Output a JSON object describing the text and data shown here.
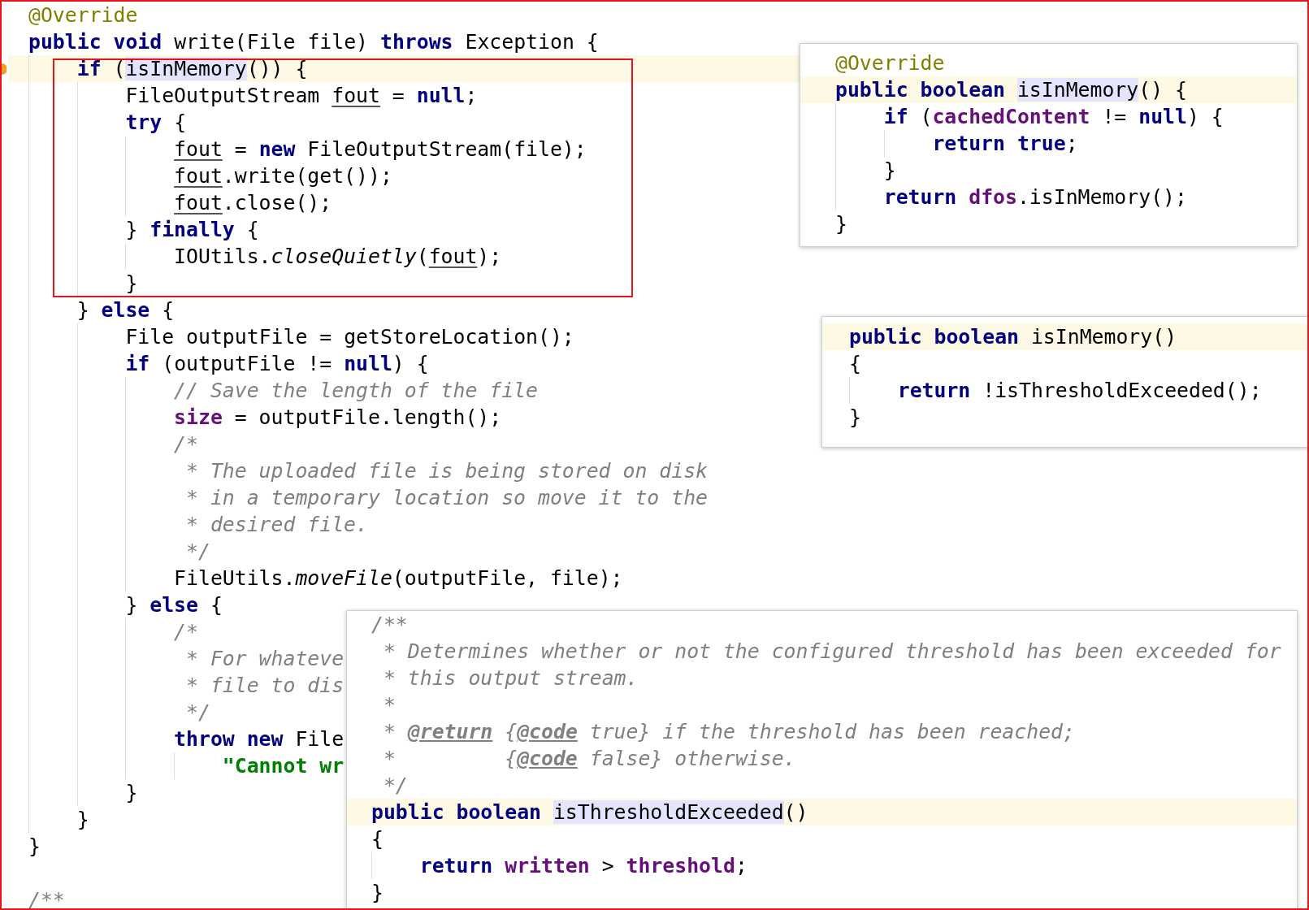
{
  "editor": {
    "lines": [
      {
        "current": false,
        "tokens": [
          {
            "text": "@Override",
            "kind": "ann"
          }
        ]
      },
      {
        "current": false,
        "tokens": [
          {
            "text": "public void ",
            "kind": "kw"
          },
          {
            "text": "write(File file) ",
            "kind": "plain"
          },
          {
            "text": "throws ",
            "kind": "kw"
          },
          {
            "text": "Exception {",
            "kind": "plain"
          }
        ],
        "children": [
          {
            "current": true,
            "tokens": [
              {
                "text": "if ",
                "kind": "kw"
              },
              {
                "text": "(",
                "kind": "plain"
              },
              {
                "text": "isInMemory",
                "kind": "usage"
              },
              {
                "text": "()) {",
                "kind": "plain"
              }
            ],
            "children": [
              {
                "current": false,
                "tokens": [
                  {
                    "text": "FileOutputStream ",
                    "kind": "plain"
                  },
                  {
                    "text": "fout",
                    "kind": "var"
                  },
                  {
                    "text": " = ",
                    "kind": "plain"
                  },
                  {
                    "text": "null",
                    "kind": "kw"
                  },
                  {
                    "text": ";",
                    "kind": "plain"
                  }
                ]
              },
              {
                "current": false,
                "tokens": [
                  {
                    "text": "try ",
                    "kind": "kw"
                  },
                  {
                    "text": "{",
                    "kind": "plain"
                  }
                ],
                "children": [
                  {
                    "current": false,
                    "tokens": [
                      {
                        "text": "fout",
                        "kind": "var"
                      },
                      {
                        "text": " = ",
                        "kind": "plain"
                      },
                      {
                        "text": "new ",
                        "kind": "kw"
                      },
                      {
                        "text": "FileOutputStream(file);",
                        "kind": "plain"
                      }
                    ]
                  },
                  {
                    "current": false,
                    "tokens": [
                      {
                        "text": "fout",
                        "kind": "var"
                      },
                      {
                        "text": ".write(get());",
                        "kind": "plain"
                      }
                    ]
                  },
                  {
                    "current": false,
                    "tokens": [
                      {
                        "text": "fout",
                        "kind": "var"
                      },
                      {
                        "text": ".close();",
                        "kind": "plain"
                      }
                    ]
                  }
                ]
              },
              {
                "current": false,
                "tokens": [
                  {
                    "text": "} ",
                    "kind": "plain"
                  },
                  {
                    "text": "finally ",
                    "kind": "kw"
                  },
                  {
                    "text": "{",
                    "kind": "plain"
                  }
                ],
                "children": [
                  {
                    "current": false,
                    "tokens": [
                      {
                        "text": "IOUtils.",
                        "kind": "plain"
                      },
                      {
                        "text": "closeQuietly",
                        "kind": "static"
                      },
                      {
                        "text": "(",
                        "kind": "plain"
                      },
                      {
                        "text": "fout",
                        "kind": "var"
                      },
                      {
                        "text": ");",
                        "kind": "plain"
                      }
                    ]
                  }
                ]
              },
              {
                "current": false,
                "tokens": [
                  {
                    "text": "}",
                    "kind": "plain"
                  }
                ]
              }
            ]
          },
          {
            "current": false,
            "tokens": [
              {
                "text": "} ",
                "kind": "plain"
              },
              {
                "text": "else ",
                "kind": "kw"
              },
              {
                "text": "{",
                "kind": "plain"
              }
            ],
            "children": [
              {
                "current": false,
                "tokens": [
                  {
                    "text": "File outputFile = getStoreLocation();",
                    "kind": "plain"
                  }
                ]
              },
              {
                "current": false,
                "tokens": [
                  {
                    "text": "if ",
                    "kind": "kw"
                  },
                  {
                    "text": "(outputFile != ",
                    "kind": "plain"
                  },
                  {
                    "text": "null",
                    "kind": "kw"
                  },
                  {
                    "text": ") {",
                    "kind": "plain"
                  }
                ],
                "children": [
                  {
                    "current": false,
                    "tokens": [
                      {
                        "text": "// Save the length of the file",
                        "kind": "comment"
                      }
                    ]
                  },
                  {
                    "current": false,
                    "tokens": [
                      {
                        "text": "size",
                        "kind": "field"
                      },
                      {
                        "text": " = outputFile.length();",
                        "kind": "plain"
                      }
                    ]
                  },
                  {
                    "current": false,
                    "tokens": [
                      {
                        "text": "/*",
                        "kind": "comment"
                      }
                    ]
                  },
                  {
                    "current": false,
                    "tokens": [
                      {
                        "text": " * The uploaded file is being stored on disk",
                        "kind": "comment"
                      }
                    ]
                  },
                  {
                    "current": false,
                    "tokens": [
                      {
                        "text": " * in a temporary location so move it to the",
                        "kind": "comment"
                      }
                    ]
                  },
                  {
                    "current": false,
                    "tokens": [
                      {
                        "text": " * desired file.",
                        "kind": "comment"
                      }
                    ]
                  },
                  {
                    "current": false,
                    "tokens": [
                      {
                        "text": " */",
                        "kind": "comment"
                      }
                    ]
                  },
                  {
                    "current": false,
                    "tokens": [
                      {
                        "text": "FileUtils.",
                        "kind": "plain"
                      },
                      {
                        "text": "moveFile",
                        "kind": "static"
                      },
                      {
                        "text": "(outputFile, file);",
                        "kind": "plain"
                      }
                    ]
                  }
                ]
              },
              {
                "current": false,
                "tokens": [
                  {
                    "text": "} ",
                    "kind": "plain"
                  },
                  {
                    "text": "else ",
                    "kind": "kw"
                  },
                  {
                    "text": "{",
                    "kind": "plain"
                  }
                ],
                "children": [
                  {
                    "current": false,
                    "tokens": [
                      {
                        "text": "/*",
                        "kind": "comment"
                      }
                    ]
                  },
                  {
                    "current": false,
                    "tokens": [
                      {
                        "text": " * For whateve",
                        "kind": "comment"
                      }
                    ]
                  },
                  {
                    "current": false,
                    "tokens": [
                      {
                        "text": " * file to dis",
                        "kind": "comment"
                      }
                    ]
                  },
                  {
                    "current": false,
                    "tokens": [
                      {
                        "text": " */",
                        "kind": "comment"
                      }
                    ]
                  },
                  {
                    "current": false,
                    "tokens": [
                      {
                        "text": "throw new ",
                        "kind": "kw"
                      },
                      {
                        "text": "File",
                        "kind": "plain"
                      }
                    ],
                    "children": [
                      {
                        "current": false,
                        "tokens": [
                          {
                            "text": "\"Cannot wr",
                            "kind": "string"
                          }
                        ]
                      }
                    ]
                  }
                ]
              },
              {
                "current": false,
                "tokens": [
                  {
                    "text": "}",
                    "kind": "plain"
                  }
                ]
              }
            ]
          },
          {
            "current": false,
            "tokens": [
              {
                "text": "}",
                "kind": "plain"
              }
            ]
          }
        ]
      },
      {
        "current": false,
        "tokens": [
          {
            "text": "}",
            "kind": "plain"
          }
        ]
      },
      {
        "current": false
      },
      {
        "current": false,
        "tokens": [
          {
            "text": "/**",
            "kind": "comment"
          }
        ]
      }
    ]
  },
  "popups": [
    {
      "lines": [
        {
          "current": false,
          "tokens": [
            {
              "text": "@Override",
              "kind": "ann"
            }
          ]
        },
        {
          "current": true,
          "tokens": [
            {
              "text": "public boolean ",
              "kind": "kw"
            },
            {
              "text": "isInMemory",
              "kind": "usage"
            },
            {
              "text": "() {",
              "kind": "plain"
            }
          ],
          "children": [
            {
              "current": false,
              "tokens": [
                {
                  "text": "if ",
                  "kind": "kw"
                },
                {
                  "text": "(",
                  "kind": "plain"
                },
                {
                  "text": "cachedContent",
                  "kind": "field"
                },
                {
                  "text": " != ",
                  "kind": "plain"
                },
                {
                  "text": "null",
                  "kind": "kw"
                },
                {
                  "text": ") {",
                  "kind": "plain"
                }
              ],
              "children": [
                {
                  "current": false,
                  "tokens": [
                    {
                      "text": "return true",
                      "kind": "kw"
                    },
                    {
                      "text": ";",
                      "kind": "plain"
                    }
                  ]
                }
              ]
            },
            {
              "current": false,
              "tokens": [
                {
                  "text": "}",
                  "kind": "plain"
                }
              ]
            },
            {
              "current": false,
              "tokens": [
                {
                  "text": "return ",
                  "kind": "kw"
                },
                {
                  "text": "dfos",
                  "kind": "field"
                },
                {
                  "text": ".isInMemory();",
                  "kind": "plain"
                }
              ]
            }
          ]
        },
        {
          "current": false,
          "tokens": [
            {
              "text": "}",
              "kind": "plain"
            }
          ]
        }
      ]
    },
    {
      "lines": [
        {
          "current": true,
          "tokens": [
            {
              "text": "public boolean ",
              "kind": "kw"
            },
            {
              "text": "isInMemory()",
              "kind": "plain"
            }
          ]
        },
        {
          "current": false,
          "tokens": [
            {
              "text": "{",
              "kind": "plain"
            }
          ],
          "children": [
            {
              "current": false,
              "tokens": [
                {
                  "text": "return ",
                  "kind": "kw"
                },
                {
                  "text": "!isThresholdExceeded();",
                  "kind": "plain"
                }
              ]
            }
          ]
        },
        {
          "current": false,
          "tokens": [
            {
              "text": "}",
              "kind": "plain"
            }
          ]
        }
      ]
    },
    {
      "lines": [
        {
          "current": false,
          "tokens": [
            {
              "text": "/**",
              "kind": "comment"
            }
          ]
        },
        {
          "current": false,
          "tokens": [
            {
              "text": " * Determines whether or not the configured threshold has been exceeded for",
              "kind": "comment"
            }
          ]
        },
        {
          "current": false,
          "tokens": [
            {
              "text": " * this output stream.",
              "kind": "comment"
            }
          ]
        },
        {
          "current": false,
          "tokens": [
            {
              "text": " *",
              "kind": "comment"
            }
          ]
        },
        {
          "current": false,
          "tokens": [
            {
              "text": " * ",
              "kind": "comment"
            },
            {
              "text": "@return",
              "kind": "doctag"
            },
            {
              "text": " {",
              "kind": "comment"
            },
            {
              "text": "@code",
              "kind": "doctag"
            },
            {
              "text": " true} if the threshold has been reached;",
              "kind": "comment"
            }
          ]
        },
        {
          "current": false,
          "tokens": [
            {
              "text": " *         {",
              "kind": "comment"
            },
            {
              "text": "@code",
              "kind": "doctag"
            },
            {
              "text": " false} otherwise.",
              "kind": "comment"
            }
          ]
        },
        {
          "current": false,
          "tokens": [
            {
              "text": " */",
              "kind": "comment"
            }
          ]
        },
        {
          "current": true,
          "tokens": [
            {
              "text": "public boolean ",
              "kind": "kw"
            },
            {
              "text": "isThresholdExceeded",
              "kind": "usage"
            },
            {
              "text": "()",
              "kind": "plain"
            }
          ]
        },
        {
          "current": false,
          "tokens": [
            {
              "text": "{",
              "kind": "plain"
            }
          ],
          "children": [
            {
              "current": false,
              "tokens": [
                {
                  "text": "return ",
                  "kind": "kw"
                },
                {
                  "text": "written",
                  "kind": "field"
                },
                {
                  "text": " > ",
                  "kind": "plain"
                },
                {
                  "text": "threshold",
                  "kind": "field"
                },
                {
                  "text": ";",
                  "kind": "plain"
                }
              ]
            }
          ]
        },
        {
          "current": false,
          "tokens": [
            {
              "text": "}",
              "kind": "plain"
            }
          ]
        }
      ]
    }
  ]
}
